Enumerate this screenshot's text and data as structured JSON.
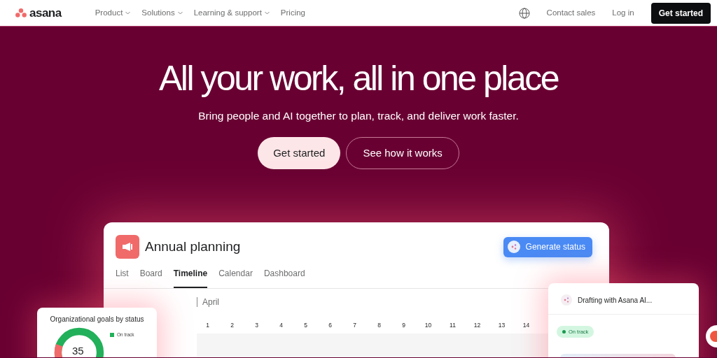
{
  "nav": {
    "logo": "asana",
    "menu": [
      {
        "label": "Product",
        "dropdown": true
      },
      {
        "label": "Solutions",
        "dropdown": true
      },
      {
        "label": "Learning & support",
        "dropdown": true
      },
      {
        "label": "Pricing",
        "dropdown": false
      }
    ],
    "contact": "Contact sales",
    "login": "Log in",
    "cta": "Get started"
  },
  "hero": {
    "title": "All your work, all in one place",
    "subtitle": "Bring people and AI together to plan, track, and deliver work faster.",
    "buttons": [
      {
        "label": "Get started",
        "kind": "primary"
      },
      {
        "label": "See how it works",
        "kind": "outline"
      }
    ]
  },
  "project": {
    "title": "Annual planning",
    "action": "Generate status",
    "tabs": [
      {
        "label": "List",
        "selected": false
      },
      {
        "label": "Board",
        "selected": false
      },
      {
        "label": "Timeline",
        "selected": true
      },
      {
        "label": "Calendar",
        "selected": false
      },
      {
        "label": "Dashboard",
        "selected": false
      }
    ],
    "month": "April",
    "days": [
      "1",
      "2",
      "3",
      "4",
      "5",
      "6",
      "7",
      "8",
      "9",
      "10",
      "11",
      "12",
      "13",
      "14"
    ]
  },
  "goals_card": {
    "title": "Organizational goals by status",
    "total": "35",
    "legend": [
      {
        "label": "On track"
      }
    ]
  },
  "ai_card": {
    "title": "Drafting with Asana AI...",
    "status": "On track"
  }
}
